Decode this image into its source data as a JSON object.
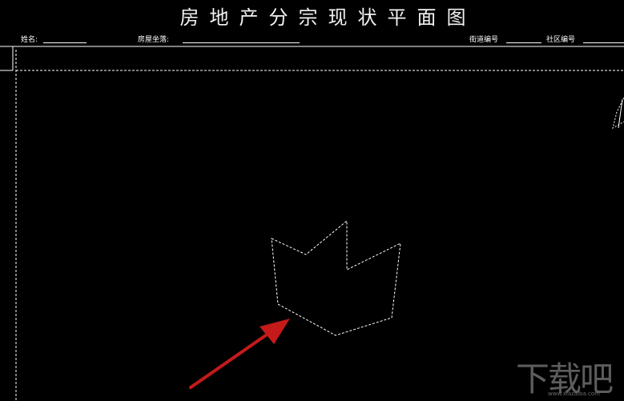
{
  "drawing": {
    "title": "房地产分宗现状平面图",
    "fields": {
      "name_label": "姓名:",
      "address_label": "房屋坐落:",
      "street_label": "街道编号",
      "community_label": "社区编号"
    }
  },
  "colors": {
    "background": "#000000",
    "lines": "#ffffff",
    "arrow": "#c41a1a",
    "watermark": "#6e6e6e"
  },
  "watermark": {
    "logo_text": "下载吧",
    "url": "www.xiazaiba.com"
  }
}
